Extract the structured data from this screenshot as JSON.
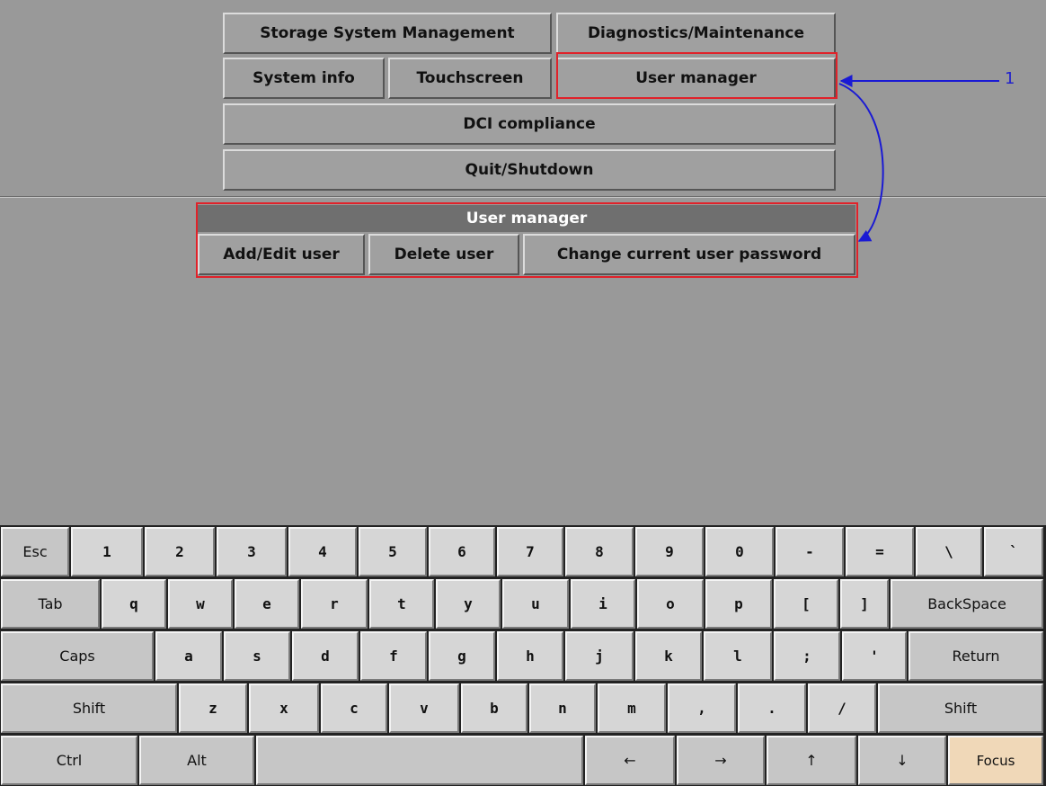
{
  "menu": {
    "storage": "Storage System Management",
    "diagnostics": "Diagnostics/Maintenance",
    "system_info": "System info",
    "touchscreen": "Touchscreen",
    "user_manager": "User manager",
    "dci": "DCI compliance",
    "quit": "Quit/Shutdown"
  },
  "submenu": {
    "title": "User manager",
    "add_edit": "Add/Edit user",
    "delete": "Delete user",
    "change_password": "Change current user password"
  },
  "annotation": {
    "callout_number": "1",
    "arrow_color": "#1a1ad4",
    "highlight_color": "#e0222a"
  },
  "keyboard": {
    "row1": [
      "Esc",
      "1",
      "2",
      "3",
      "4",
      "5",
      "6",
      "7",
      "8",
      "9",
      "0",
      "-",
      "=",
      "\\",
      "`"
    ],
    "row2": [
      "Tab",
      "q",
      "w",
      "e",
      "r",
      "t",
      "y",
      "u",
      "i",
      "o",
      "p",
      "[",
      "]",
      "BackSpace"
    ],
    "row3": [
      "Caps",
      "a",
      "s",
      "d",
      "f",
      "g",
      "h",
      "j",
      "k",
      "l",
      ";",
      "'",
      "Return"
    ],
    "row4": [
      "Shift",
      "z",
      "x",
      "c",
      "v",
      "b",
      "n",
      "m",
      ",",
      ".",
      "/",
      "Shift"
    ],
    "row5": [
      "Ctrl",
      "Alt",
      "",
      "←",
      "→",
      "↑",
      "↓",
      "Focus"
    ]
  }
}
